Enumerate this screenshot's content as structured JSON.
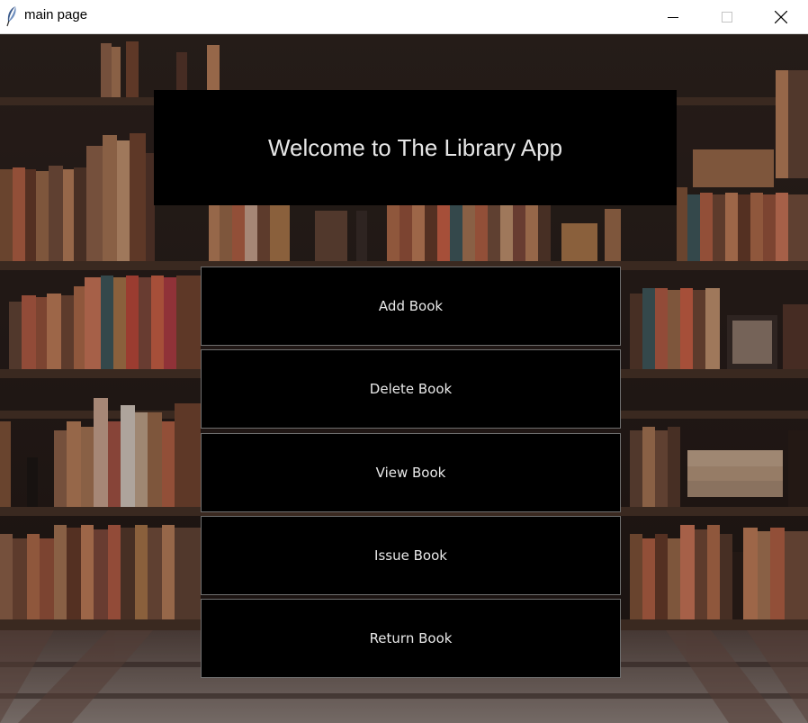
{
  "window": {
    "title": "main page",
    "icons": {
      "app": "feather-icon",
      "minimize": "minimize-icon",
      "maximize": "maximize-icon",
      "close": "close-icon"
    }
  },
  "background": {
    "description_icon": "bookshelf-background",
    "colors": {
      "wall": "#2a1e18",
      "shelf": "#4a3327",
      "floor": "#8b7f7a"
    }
  },
  "header": {
    "text": "Welcome to The Library App",
    "bg": "#000000",
    "color": "#e6e6e6"
  },
  "menu": {
    "buttons": [
      {
        "label": "Add Book"
      },
      {
        "label": "Delete Book"
      },
      {
        "label": "View Book"
      },
      {
        "label": "Issue Book"
      },
      {
        "label": "Return Book"
      }
    ]
  }
}
